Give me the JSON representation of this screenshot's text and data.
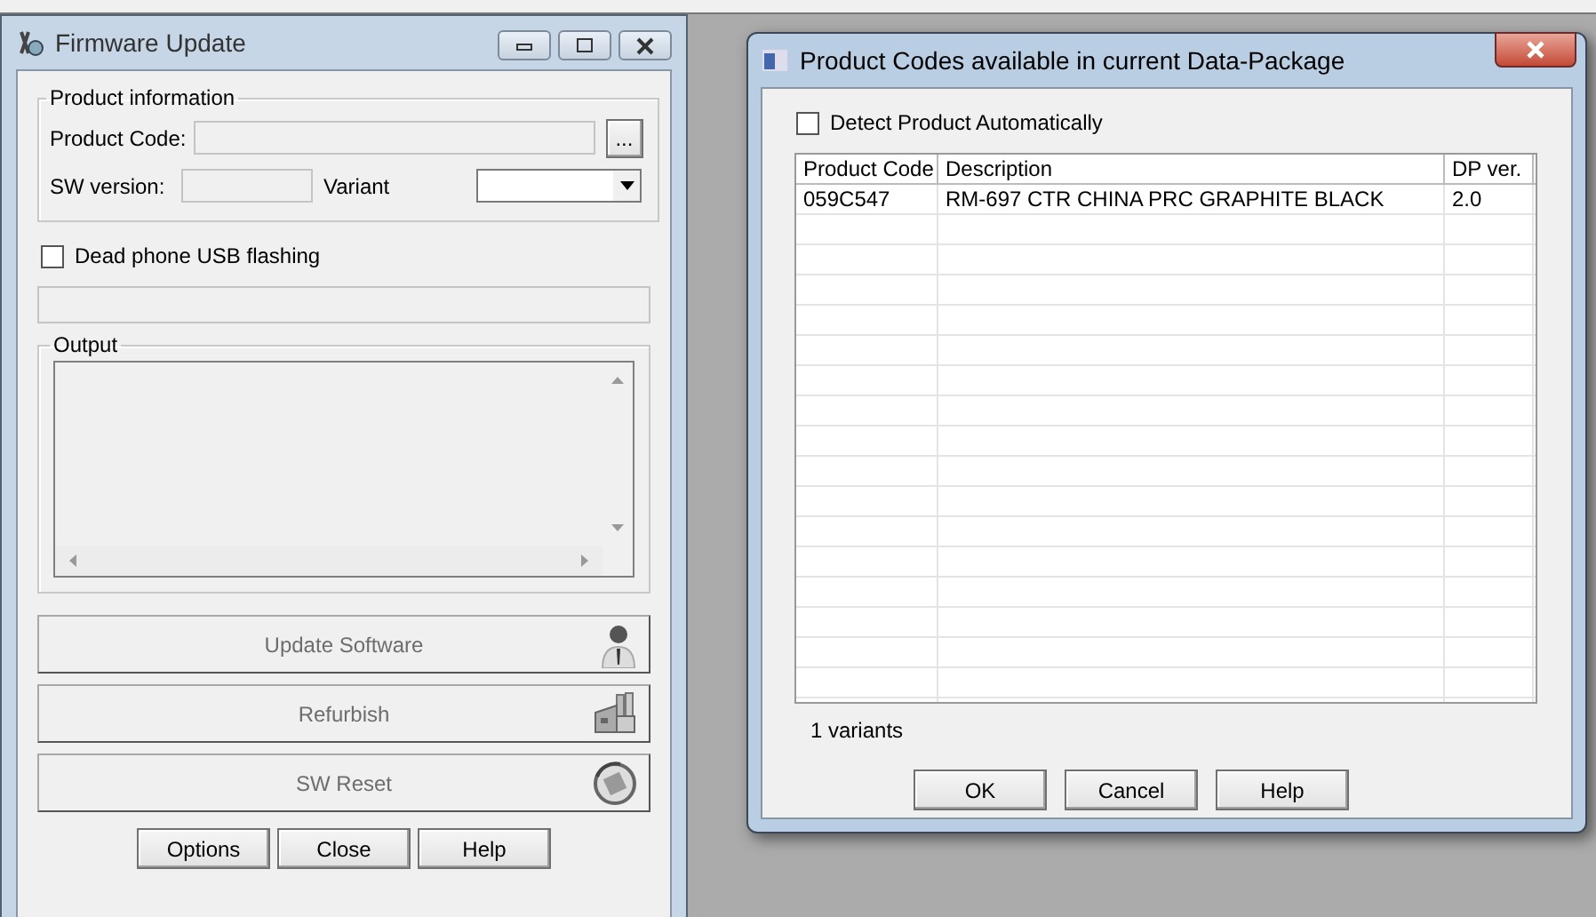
{
  "main_window": {
    "title": "Firmware Update",
    "product_information": {
      "title": "Product information",
      "product_code_label": "Product Code:",
      "browse_button": "...",
      "sw_version_label": "SW version:",
      "variant_label": "Variant"
    },
    "dead_phone": {
      "label": "Dead phone USB flashing",
      "checked": false
    },
    "output": {
      "title": "Output"
    },
    "progress": {
      "level": 0
    },
    "actions": [
      {
        "label": "Update Software",
        "kind": "person",
        "disabled": true
      },
      {
        "label": "Refurbish",
        "kind": "factory",
        "disabled": true
      },
      {
        "label": "SW Reset",
        "kind": "reset",
        "disabled": true
      }
    ],
    "buttons": [
      {
        "label": "Options",
        "disabled": false
      },
      {
        "label": "Close",
        "disabled": false
      },
      {
        "label": "Help",
        "disabled": false
      }
    ]
  },
  "dialog": {
    "title": "Product Codes available in current Data-Package",
    "detect": {
      "label": "Detect Product Automatically",
      "checked": false
    },
    "table": {
      "columns": [
        "Product Code",
        "Description",
        "DP ver."
      ],
      "rows": [
        [
          "059C547",
          "RM-697 CTR CHINA PRC GRAPHITE BLACK",
          "2.0"
        ]
      ]
    },
    "count": "1 variants",
    "buttons": [
      "OK",
      "Cancel",
      "Help"
    ]
  }
}
